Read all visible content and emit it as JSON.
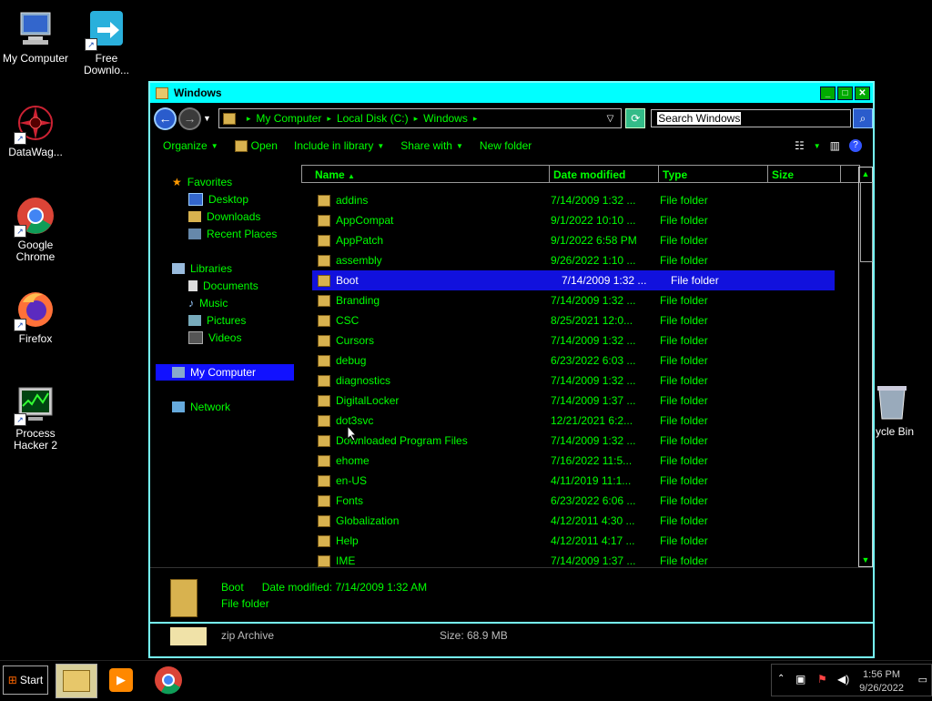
{
  "desktop": {
    "icons": [
      {
        "label": "My Computer"
      },
      {
        "label": "Free Downlo..."
      },
      {
        "label": "DataWag..."
      },
      {
        "label": "Google Chrome"
      },
      {
        "label": "Firefox"
      },
      {
        "label": "Process Hacker 2"
      },
      {
        "label": "ycle Bin"
      }
    ]
  },
  "window": {
    "title": "Windows",
    "address": [
      "My Computer",
      "Local Disk (C:)",
      "Windows"
    ],
    "search_placeholder": "Search Windows",
    "toolbar": {
      "organize": "Organize",
      "open": "Open",
      "include": "Include in library",
      "share": "Share with",
      "newfolder": "New folder"
    },
    "nav": {
      "favorites": "Favorites",
      "desktop": "Desktop",
      "downloads": "Downloads",
      "recent": "Recent Places",
      "libraries": "Libraries",
      "documents": "Documents",
      "music": "Music",
      "pictures": "Pictures",
      "videos": "Videos",
      "mycomputer": "My Computer",
      "network": "Network"
    },
    "columns": {
      "name": "Name",
      "date": "Date modified",
      "type": "Type",
      "size": "Size"
    },
    "files": [
      {
        "name": "addins",
        "date": "7/14/2009 1:32 ...",
        "type": "File folder"
      },
      {
        "name": "AppCompat",
        "date": "9/1/2022 10:10 ...",
        "type": "File folder"
      },
      {
        "name": "AppPatch",
        "date": "9/1/2022 6:58 PM",
        "type": "File folder"
      },
      {
        "name": "assembly",
        "date": "9/26/2022 1:10 ...",
        "type": "File folder"
      },
      {
        "name": "Boot",
        "date": "7/14/2009 1:32 ...",
        "type": "File folder"
      },
      {
        "name": "Branding",
        "date": "7/14/2009 1:32 ...",
        "type": "File folder"
      },
      {
        "name": "CSC",
        "date": "8/25/2021 12:0...",
        "type": "File folder"
      },
      {
        "name": "Cursors",
        "date": "7/14/2009 1:32 ...",
        "type": "File folder"
      },
      {
        "name": "debug",
        "date": "6/23/2022 6:03 ...",
        "type": "File folder"
      },
      {
        "name": "diagnostics",
        "date": "7/14/2009 1:32 ...",
        "type": "File folder"
      },
      {
        "name": "DigitalLocker",
        "date": "7/14/2009 1:37 ...",
        "type": "File folder"
      },
      {
        "name": "dot3svc",
        "date": "12/21/2021 6:2...",
        "type": "File folder"
      },
      {
        "name": "Downloaded Program Files",
        "date": "7/14/2009 1:32 ...",
        "type": "File folder"
      },
      {
        "name": "ehome",
        "date": "7/16/2022 11:5...",
        "type": "File folder"
      },
      {
        "name": "en-US",
        "date": "4/11/2019 11:1...",
        "type": "File folder"
      },
      {
        "name": "Fonts",
        "date": "6/23/2022 6:06 ...",
        "type": "File folder"
      },
      {
        "name": "Globalization",
        "date": "4/12/2011 4:30 ...",
        "type": "File folder"
      },
      {
        "name": "Help",
        "date": "4/12/2011 4:17 ...",
        "type": "File folder"
      },
      {
        "name": "IME",
        "date": "7/14/2009 1:37 ...",
        "type": "File folder"
      }
    ],
    "details": {
      "name": "Boot",
      "date_label": "Date modified:",
      "date_value": "7/14/2009 1:32 AM",
      "type": "File folder"
    },
    "status": {
      "type": "zip Archive",
      "size": "Size: 68.9 MB"
    }
  },
  "taskbar": {
    "start": "Start",
    "time": "1:56 PM",
    "date": "9/26/2022"
  },
  "colors": {
    "accent": "#00ffff",
    "text": "#00ff00",
    "selection": "#1111dd"
  }
}
